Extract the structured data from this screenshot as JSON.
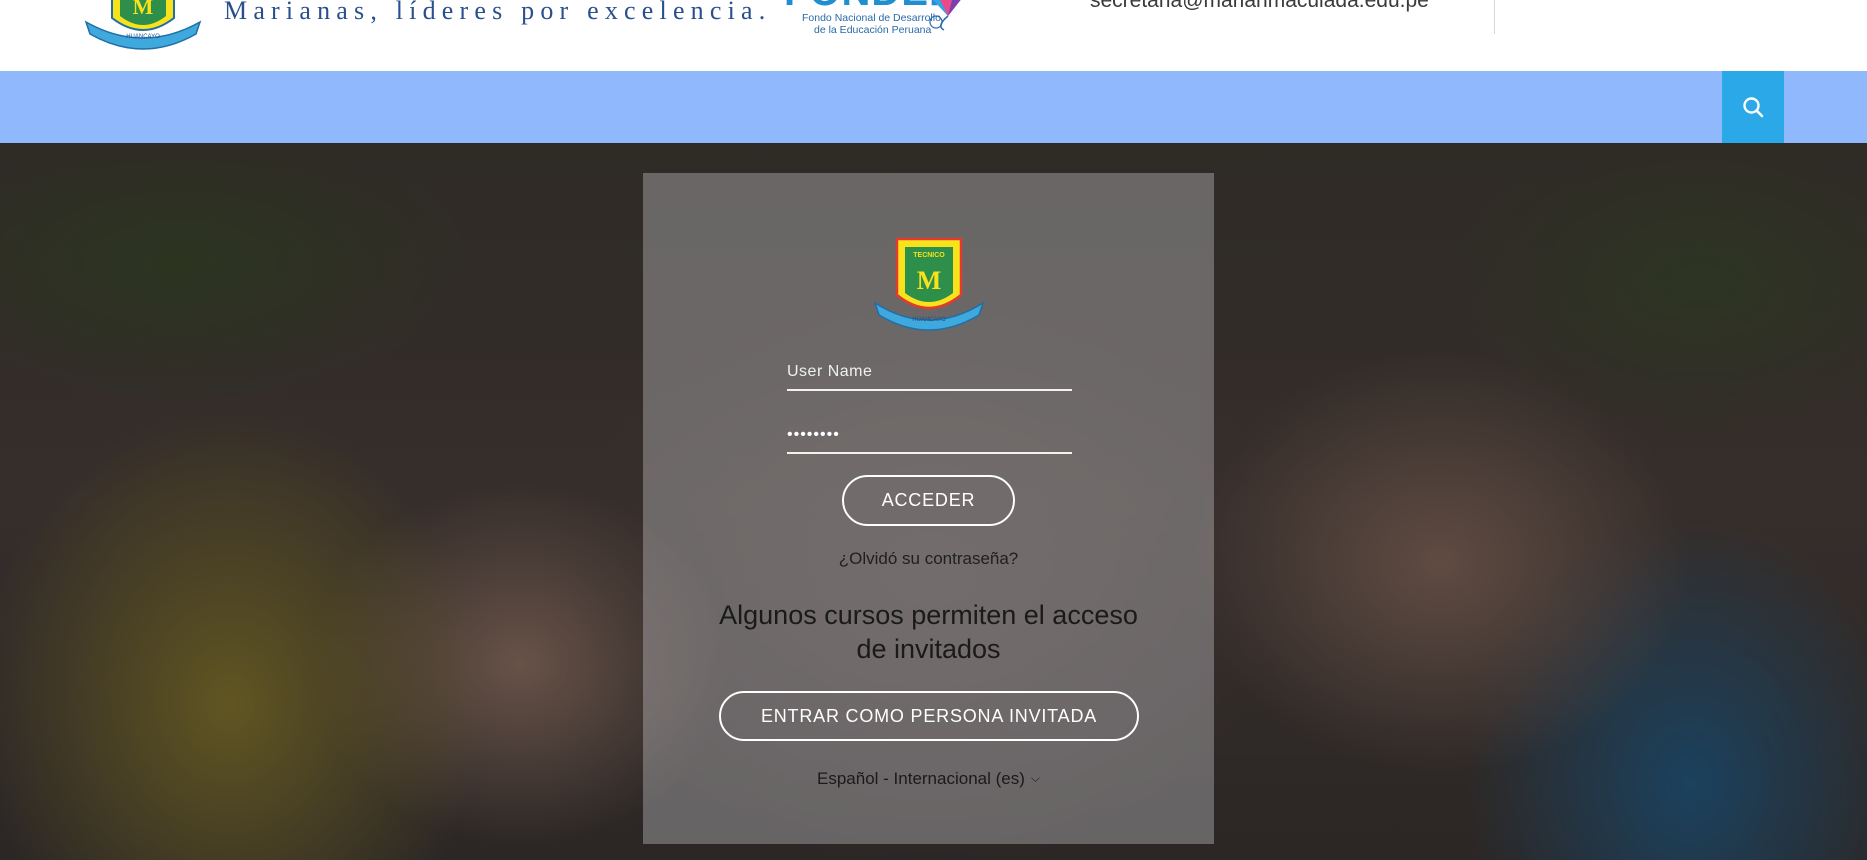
{
  "header": {
    "slogan": "Marianas, líderes por excelencia.",
    "partner_logo": {
      "word": "FONDEP",
      "line1": "Fondo Nacional de Desarrollo",
      "line2": "de la Educación Peruana"
    },
    "email": "secretaria@marianmaculada.edu.pe"
  },
  "school_logo": {
    "top_text": "TECNICO",
    "monogram": "M",
    "bottom_text": "HUANCAYO"
  },
  "nav": {
    "search_icon": "search-icon"
  },
  "login": {
    "username_placeholder": "User Name",
    "password_value": "••••••••",
    "submit_label": "ACCEDER",
    "forgot_label": "¿Olvidó su contraseña?",
    "guest_title": "Algunos cursos permiten el acceso de invitados",
    "guest_button_label": "ENTRAR COMO PERSONA INVITADA",
    "language": "Español - Internacional (es)"
  },
  "colors": {
    "nav_background": "#90b9fd",
    "search_button": "#2aa8e8",
    "slogan_text": "#2a4f8e"
  }
}
